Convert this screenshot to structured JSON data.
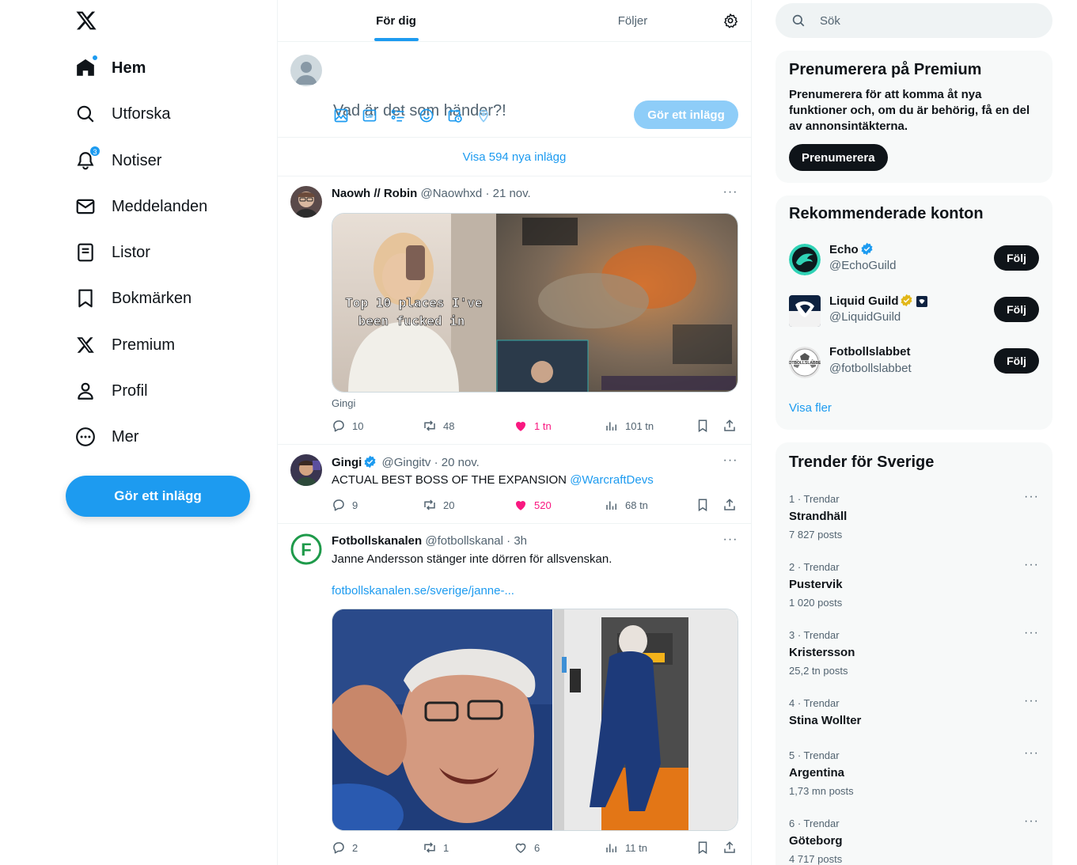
{
  "nav": {
    "items": [
      {
        "label": "Hem",
        "icon": "home-icon"
      },
      {
        "label": "Utforska",
        "icon": "search-icon"
      },
      {
        "label": "Notiser",
        "icon": "bell-icon",
        "badge": "3"
      },
      {
        "label": "Meddelanden",
        "icon": "mail-icon"
      },
      {
        "label": "Listor",
        "icon": "list-icon"
      },
      {
        "label": "Bokmärken",
        "icon": "bookmark-icon"
      },
      {
        "label": "Premium",
        "icon": "x-logo-icon"
      },
      {
        "label": "Profil",
        "icon": "person-icon"
      },
      {
        "label": "Mer",
        "icon": "more-circle-icon"
      }
    ],
    "post_button": "Gör ett inlägg"
  },
  "tabs": [
    "För dig",
    "Följer"
  ],
  "composer": {
    "placeholder": "Vad är det som händer?!",
    "post_button": "Gör ett inlägg"
  },
  "show_new": "Visa 594 nya inlägg",
  "tweets": [
    {
      "name": "Naowh // Robin",
      "handle": "@Naowhxd",
      "time": "· 21 nov.",
      "media_caption_left": "Top 10 places I've been fucked in",
      "caption": "Gingi",
      "replies": "10",
      "retweets": "48",
      "likes": "1 tn",
      "views": "101 tn"
    },
    {
      "name": "Gingi",
      "handle": "@Gingitv",
      "time": "· 20 nov.",
      "text": "ACTUAL BEST BOSS OF THE EXPANSION",
      "mention": "@WarcraftDevs",
      "replies": "9",
      "retweets": "20",
      "likes": "520",
      "views": "68 tn"
    },
    {
      "name": "Fotbollskanalen",
      "handle": "@fotbollskanal",
      "time": "· 3h",
      "text": "Janne Andersson stänger inte dörren för allsvenskan.",
      "link": "fotbollskanalen.se/sverige/janne-...",
      "replies": "2",
      "retweets": "1",
      "likes": "6",
      "views": "11 tn"
    }
  ],
  "search": {
    "placeholder": "Sök"
  },
  "premium": {
    "title": "Prenumerera på Premium",
    "text": "Prenumerera för att komma åt nya funktioner och, om du är behörig, få en del av annonsintäkterna.",
    "button": "Prenumerera"
  },
  "recommended": {
    "title": "Rekommenderade konton",
    "accounts": [
      {
        "name": "Echo",
        "handle": "@EchoGuild",
        "button": "Följ"
      },
      {
        "name": "Liquid Guild",
        "handle": "@LiquidGuild",
        "button": "Följ"
      },
      {
        "name": "Fotbollslabbet",
        "handle": "@fotbollslabbet",
        "button": "Följ"
      }
    ],
    "show_more": "Visa fler"
  },
  "trends": {
    "title": "Trender för Sverige",
    "items": [
      {
        "meta": "1 · Trendar",
        "name": "Strandhäll",
        "count": "7 827 posts"
      },
      {
        "meta": "2 · Trendar",
        "name": "Pustervik",
        "count": "1 020 posts"
      },
      {
        "meta": "3 · Trendar",
        "name": "Kristersson",
        "count": "25,2 tn posts"
      },
      {
        "meta": "4 · Trendar",
        "name": "Stina Wollter",
        "count": ""
      },
      {
        "meta": "5 · Trendar",
        "name": "Argentina",
        "count": "1,73 mn posts"
      },
      {
        "meta": "6 · Trendar",
        "name": "Göteborg",
        "count": "4 717 posts"
      }
    ]
  },
  "colors": {
    "accent": "#1d9bf0",
    "like": "#f91880",
    "text": "#0f1419",
    "muted": "#536471"
  }
}
